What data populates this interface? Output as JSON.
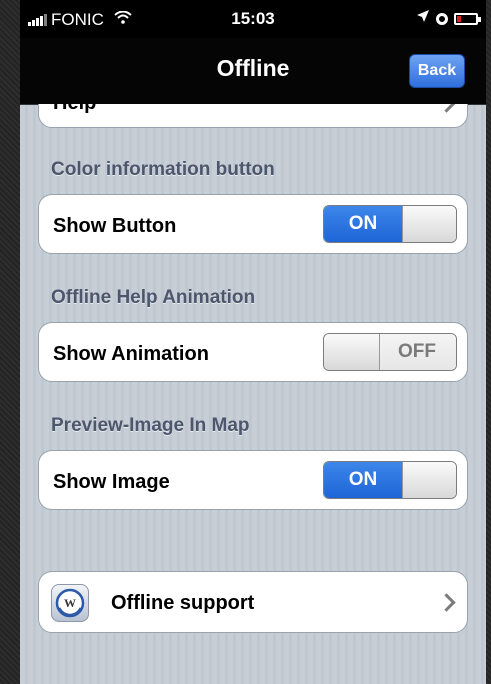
{
  "status_bar": {
    "carrier": "FONIC",
    "time": "15:03"
  },
  "nav": {
    "title": "Offline",
    "back_label": "Back"
  },
  "partial_cell": {
    "label": "Help"
  },
  "sections": [
    {
      "header": "Color information button",
      "row_label": "Show Button",
      "toggle": "ON"
    },
    {
      "header": "Offline Help Animation",
      "row_label": "Show Animation",
      "toggle": "OFF"
    },
    {
      "header": "Preview-Image In Map",
      "row_label": "Show Image",
      "toggle": "ON"
    }
  ],
  "support": {
    "label": "Offline support",
    "icon_letter": "W"
  },
  "colors": {
    "toggle_on": "#2a72e0",
    "nav_bg": "#050505",
    "back_button": "#3d7fe6",
    "group_bg": "#c5ccd4"
  }
}
